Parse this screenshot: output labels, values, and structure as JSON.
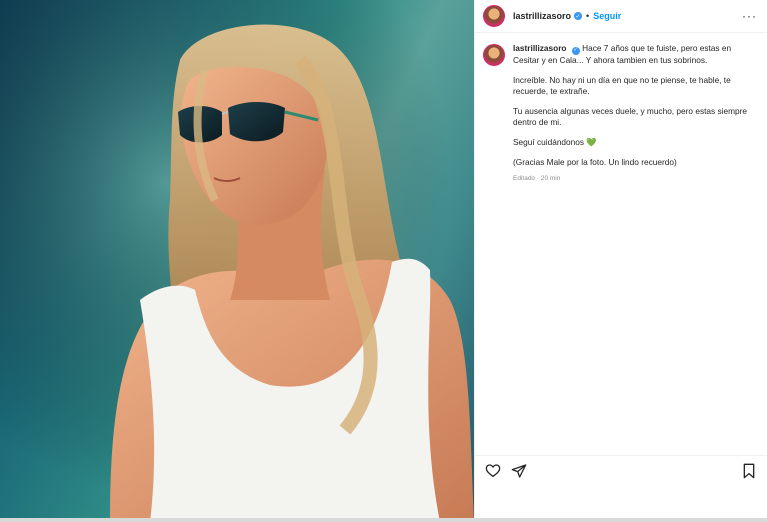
{
  "post": {
    "image_alt": "Young woman with long blond hair wearing sunglasses and a white tank top",
    "colors": {
      "accent": "#0095f6",
      "verified": "#3897f0",
      "text": "#262626",
      "muted": "#8e8e8e"
    }
  },
  "header": {
    "username": "lastrillizasoro",
    "dot": "•",
    "follow_label": "Seguir",
    "more_label": "···"
  },
  "caption": {
    "username": "lastrillizasoro",
    "line1": "Hace 7 años que te fuiste, pero estas en Cesitar y en Cala... Y ahora tambien en tus sobrinos.",
    "line2": "Increíble. No hay ni un día en que no te piense, te hable, te recuerde, te extrañe.",
    "line3": "Tu ausencia algunas veces duele, y mucho, pero estas siempre dentro de mi.",
    "line4": "Seguí cuidándonos",
    "heart": "💚",
    "line5": "(Gracias Male por la foto. Un lindo recuerdo)",
    "edited": "Editado",
    "sep": " · ",
    "time": "20 min"
  },
  "icons": {
    "like": "heart-icon",
    "share": "send-icon",
    "save": "bookmark-icon",
    "verified": "verified-badge-icon",
    "options": "more-options-icon"
  }
}
